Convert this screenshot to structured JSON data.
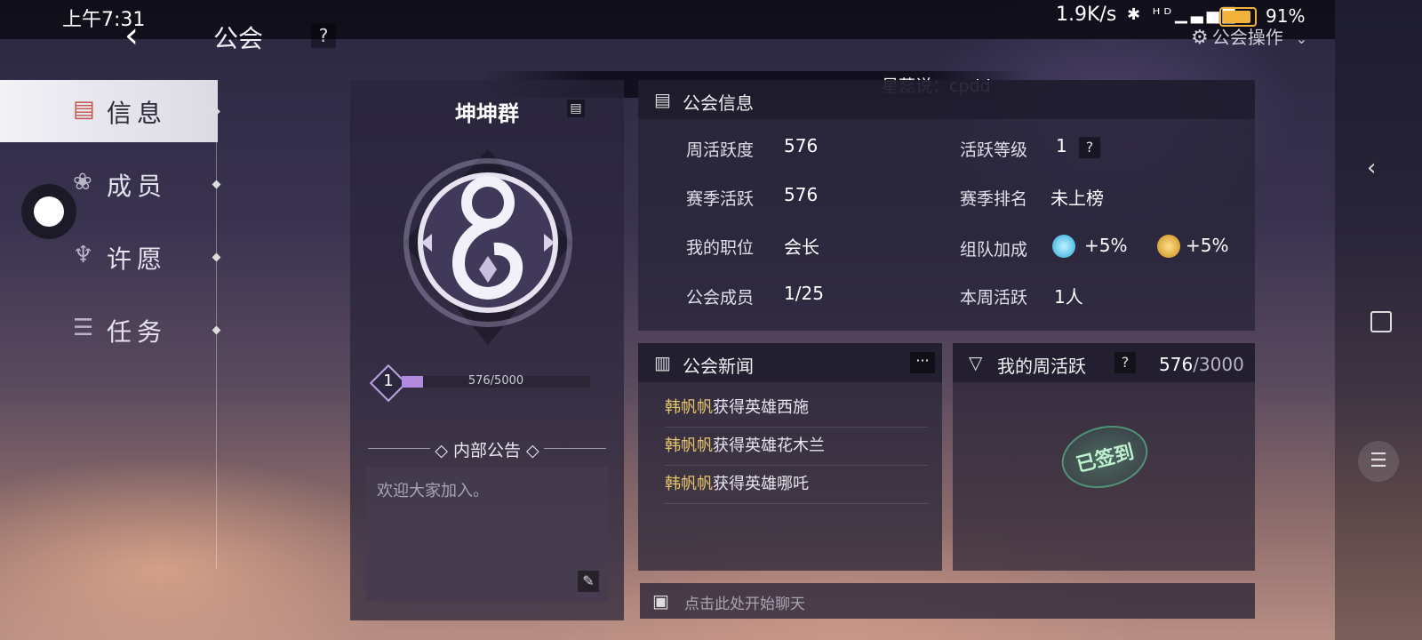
{
  "status_bar": {
    "time": "上午7:31",
    "net_speed": "1.9K/s",
    "signal_icons": "✱ ᴴᴰ▁▃▅▇",
    "battery_level": 0.91,
    "battery_text": "91%"
  },
  "header": {
    "back_glyph": "‹",
    "title": "公会",
    "help": "?",
    "guild_ops": "公会操作",
    "marquee": "星蕊说：cpdd"
  },
  "nav": {
    "items": [
      {
        "label": "信息",
        "icon": "info-doc-icon",
        "glyph": "▤"
      },
      {
        "label": "成员",
        "icon": "members-icon",
        "glyph": "❀"
      },
      {
        "label": "许愿",
        "icon": "wish-icon",
        "glyph": "♆"
      },
      {
        "label": "任务",
        "icon": "task-icon",
        "glyph": "☰"
      }
    ]
  },
  "guild": {
    "name": "坤坤群",
    "copy_glyph": "▤",
    "level": "1",
    "exp_text": "576/5000",
    "exp_progress": 0.1152,
    "notice_title": "内部公告",
    "notice_text": "欢迎大家加入。",
    "edit_glyph": "✎"
  },
  "info": {
    "title": "公会信息",
    "rows": {
      "weekly_activity_label": "周活跃度",
      "weekly_activity_value": "576",
      "season_activity_label": "赛季活跃",
      "season_activity_value": "576",
      "position_label": "我的职位",
      "position_value": "会长",
      "members_label": "公会成员",
      "members_value": "1/25",
      "activity_level_label": "活跃等级",
      "activity_level_value": "1",
      "season_rank_label": "赛季排名",
      "season_rank_value": "未上榜",
      "team_bonus_label": "组队加成",
      "team_bonus_1": "+5%",
      "team_bonus_2": "+5%",
      "weekly_active_label": "本周活跃",
      "weekly_active_value": "1人"
    }
  },
  "news": {
    "title": "公会新闻",
    "more": "···",
    "items": [
      {
        "who": "韩帆帆",
        "text": "获得英雄西施"
      },
      {
        "who": "韩帆帆",
        "text": "获得英雄花木兰"
      },
      {
        "who": "韩帆帆",
        "text": "获得英雄哪吒"
      }
    ]
  },
  "weekly": {
    "title": "我的周活跃",
    "current": "576",
    "total": "/3000",
    "stamp": "已签到"
  },
  "chat": {
    "placeholder": "点击此处开始聊天"
  },
  "system_nav": {
    "back": "‹",
    "menu": "☰"
  },
  "colors": {
    "accent_purple": "#b08be0",
    "news_name": "#e6c46a",
    "battery": "#f2b33a"
  }
}
